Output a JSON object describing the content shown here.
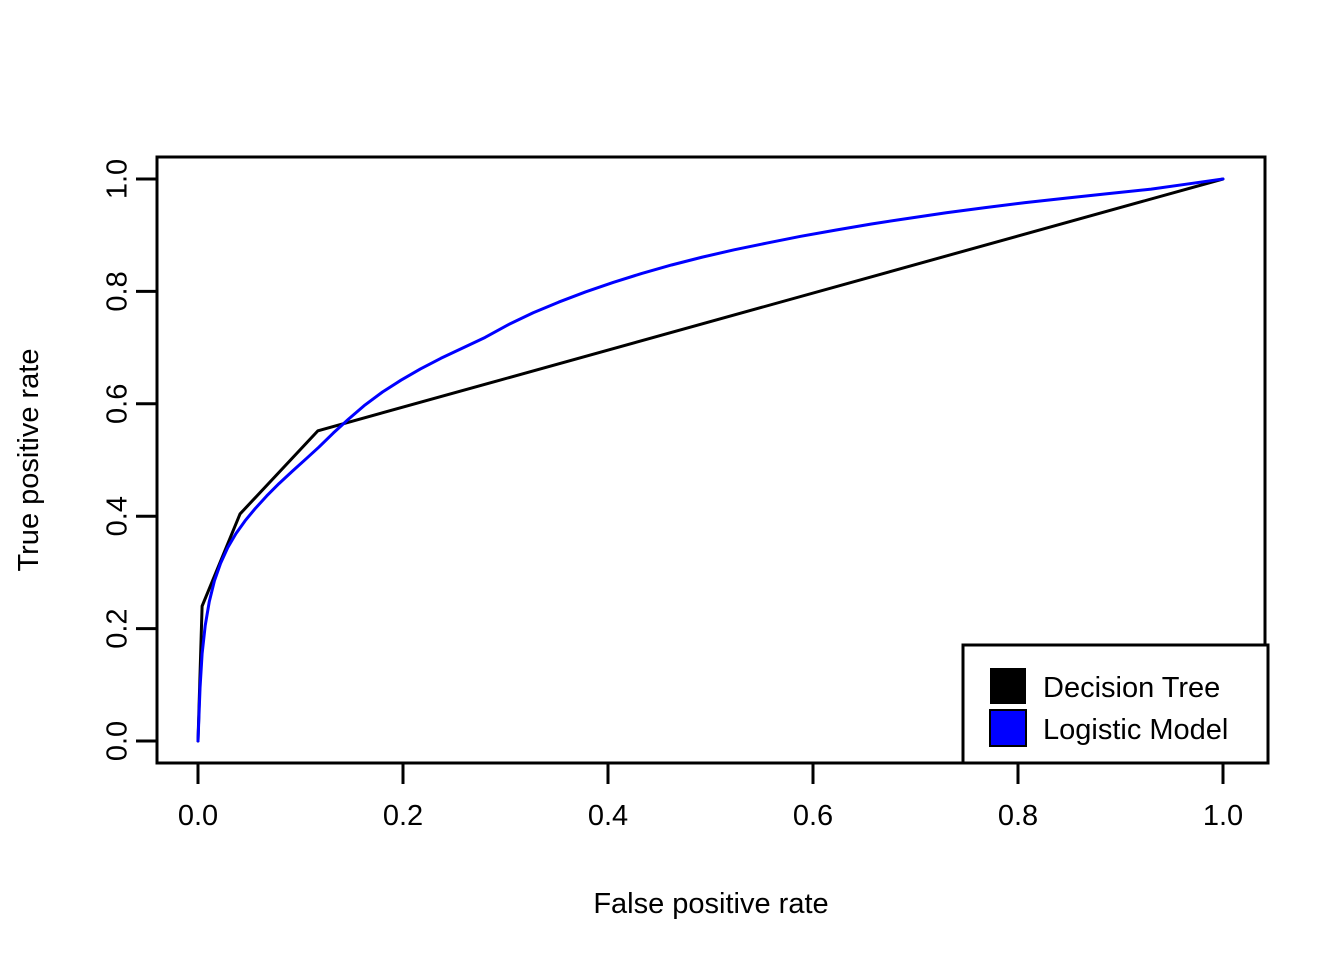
{
  "chart_data": {
    "type": "line",
    "title": "",
    "subtitle": "",
    "xlabel": "False positive rate",
    "ylabel": "True positive rate",
    "xlim": [
      0.0,
      1.0
    ],
    "ylim": [
      0.0,
      1.0
    ],
    "xticks": [
      "0.0",
      "0.2",
      "0.4",
      "0.6",
      "0.8",
      "1.0"
    ],
    "xtick_values": [
      0.0,
      0.2,
      0.4,
      0.6,
      0.8,
      1.0
    ],
    "yticks": [
      "0.0",
      "0.2",
      "0.4",
      "0.6",
      "0.8",
      "1.0"
    ],
    "ytick_values": [
      0.0,
      0.2,
      0.4,
      0.6,
      0.8,
      1.0
    ],
    "grid": false,
    "legend_position": "bottom-right",
    "series": [
      {
        "name": "Decision Tree",
        "color": "#000000",
        "style": "piecewise-linear",
        "x": [
          0.0,
          0.004,
          0.041,
          0.117,
          1.0
        ],
        "y": [
          0.0,
          0.24,
          0.404,
          0.552,
          1.0
        ]
      },
      {
        "name": "Logistic Model",
        "color": "#0000ff",
        "style": "smooth",
        "x": [
          0.0,
          0.002,
          0.004,
          0.007,
          0.011,
          0.016,
          0.022,
          0.029,
          0.037,
          0.046,
          0.056,
          0.067,
          0.079,
          0.092,
          0.106,
          0.118,
          0.132,
          0.147,
          0.163,
          0.18,
          0.198,
          0.217,
          0.237,
          0.258,
          0.28,
          0.303,
          0.327,
          0.352,
          0.378,
          0.405,
          0.433,
          0.462,
          0.492,
          0.523,
          0.555,
          0.588,
          0.622,
          0.657,
          0.693,
          0.73,
          0.768,
          0.807,
          0.847,
          0.888,
          0.93,
          0.965,
          1.0
        ],
        "y": [
          0.0,
          0.095,
          0.155,
          0.205,
          0.248,
          0.285,
          0.316,
          0.344,
          0.369,
          0.392,
          0.414,
          0.436,
          0.458,
          0.48,
          0.503,
          0.523,
          0.548,
          0.573,
          0.598,
          0.621,
          0.642,
          0.662,
          0.681,
          0.699,
          0.718,
          0.741,
          0.762,
          0.781,
          0.799,
          0.816,
          0.832,
          0.847,
          0.861,
          0.874,
          0.886,
          0.898,
          0.909,
          0.92,
          0.93,
          0.94,
          0.949,
          0.958,
          0.966,
          0.974,
          0.982,
          0.991,
          1.0
        ]
      }
    ]
  },
  "legend": {
    "items": [
      {
        "label": "Decision Tree",
        "color": "#000000",
        "swatch": "square-marker"
      },
      {
        "label": "Logistic Model",
        "color": "#0000ff",
        "swatch": "square-marker"
      }
    ]
  }
}
